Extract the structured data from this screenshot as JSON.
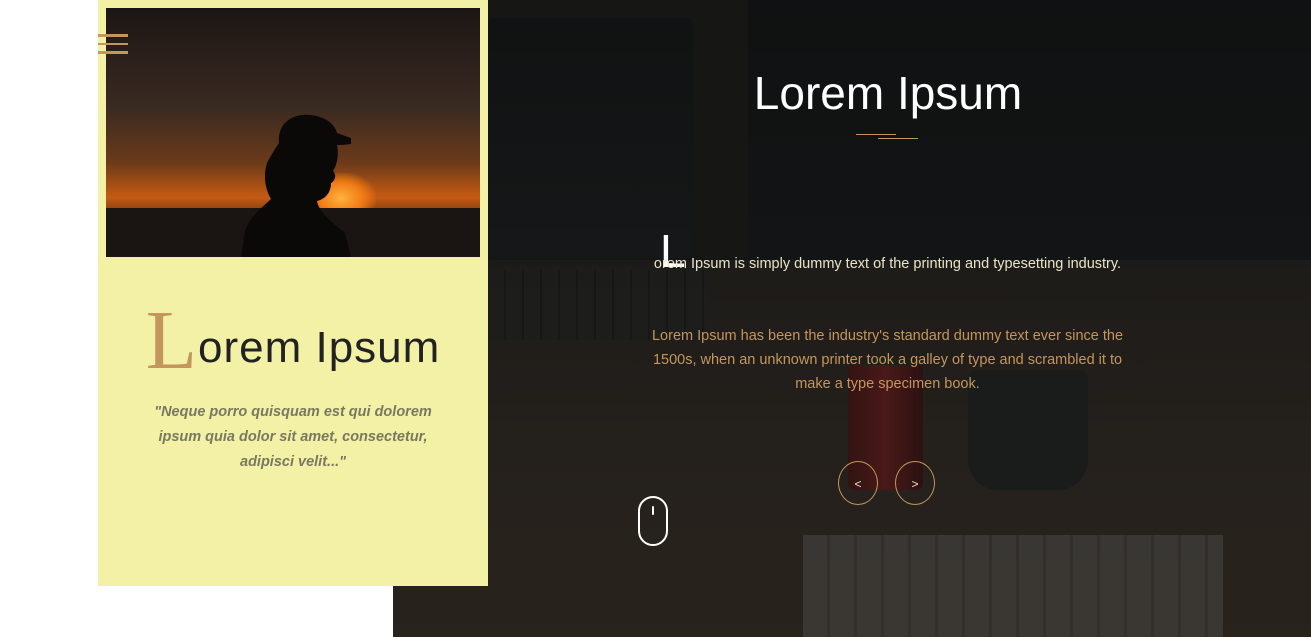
{
  "card": {
    "title_cap": "L",
    "title_rest": "orem Ipsum",
    "quote": "\"Neque porro quisquam est qui dolorem ipsum quia dolor sit amet, consectetur, adipisci velit...\""
  },
  "hero": {
    "title": "Lorem Ipsum",
    "lead_cap": "L",
    "lead_text": "orem Ipsum is simply dummy text of the printing and typesetting industry.",
    "body": "Lorem Ipsum has been the industry's standard dummy text ever since the 1500s, when an unknown printer took a galley of type and scrambled it to make a type specimen book.",
    "prev_label": "<",
    "next_label": ">"
  },
  "icons": {
    "menu": "hamburger-menu-icon",
    "scroll": "mouse-scroll-icon"
  },
  "colors": {
    "accent": "#c4965c",
    "card_bg": "#f2f1a6",
    "hero_text": "#ffffff"
  }
}
